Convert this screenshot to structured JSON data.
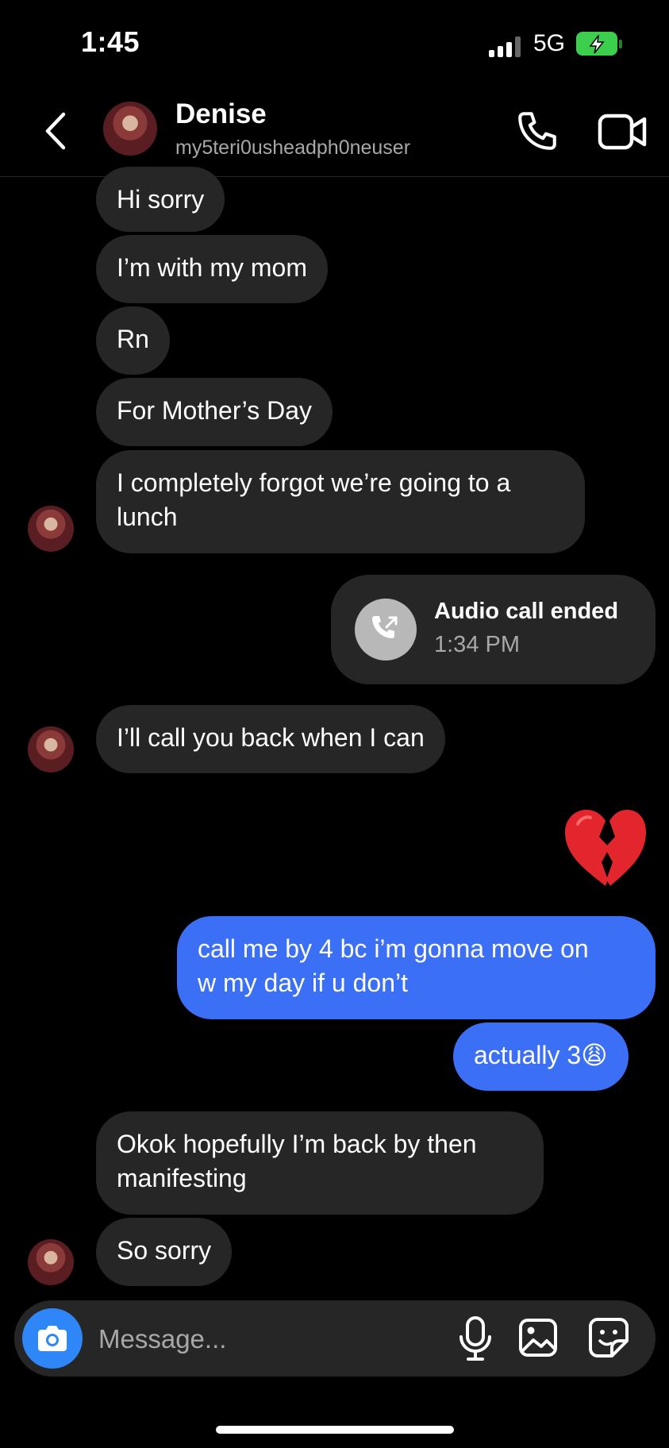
{
  "status_bar": {
    "time": "1:45",
    "network": "5G"
  },
  "header": {
    "name": "Denise",
    "username": "my5teri0usheadph0neuser"
  },
  "messages": [
    {
      "text": "Hi sorry"
    },
    {
      "text": "I’m with my mom"
    },
    {
      "text": "Rn"
    },
    {
      "text": "For Mother’s Day"
    },
    {
      "line1": "I completely forgot we’re going to a",
      "line2": "lunch"
    },
    {
      "text": "I’ll call you back when I can"
    },
    {
      "line1": "call me by 4 bc i’m gonna move on",
      "line2": "w my day if u don’t"
    },
    {
      "text": "actually 3",
      "emoji": "😩"
    },
    {
      "line1": "Okok hopefully I’m back by then",
      "line2": "manifesting"
    },
    {
      "text": "So sorry"
    }
  ],
  "call_card": {
    "title": "Audio call ended",
    "time": "1:34 PM"
  },
  "reaction": {
    "icon": "broken-heart-icon"
  },
  "composer": {
    "placeholder": "Message..."
  },
  "colors": {
    "sent_bubble": "#3b6ff5",
    "received_bubble": "#262626",
    "camera_button": "#2f87f7",
    "battery": "#3ccf4e"
  }
}
